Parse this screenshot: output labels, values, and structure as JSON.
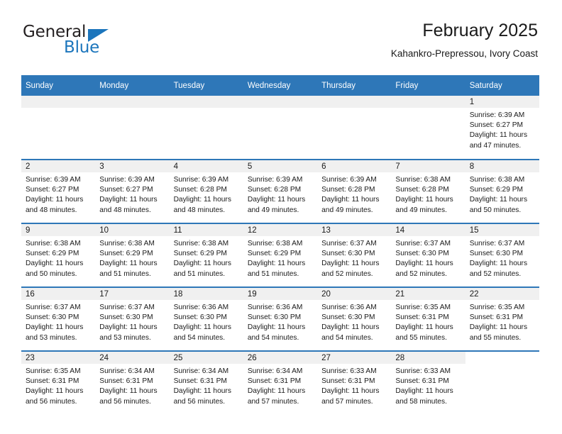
{
  "logo": {
    "primary_text": "General",
    "secondary_text": "Blue",
    "accent_color": "#1b75bc"
  },
  "header": {
    "title": "February 2025",
    "subtitle": "Kahankro-Prepressou, Ivory Coast"
  },
  "theme": {
    "header_row_color": "#2e77b8",
    "day_strip_color": "#f0f0f0",
    "text_color": "#1a1a1a"
  },
  "calendar": {
    "weekday_headers": [
      "Sunday",
      "Monday",
      "Tuesday",
      "Wednesday",
      "Thursday",
      "Friday",
      "Saturday"
    ],
    "weeks": [
      [
        {
          "day": "",
          "lines": []
        },
        {
          "day": "",
          "lines": []
        },
        {
          "day": "",
          "lines": []
        },
        {
          "day": "",
          "lines": []
        },
        {
          "day": "",
          "lines": []
        },
        {
          "day": "",
          "lines": []
        },
        {
          "day": "1",
          "lines": [
            "Sunrise: 6:39 AM",
            "Sunset: 6:27 PM",
            "Daylight: 11 hours and 47 minutes."
          ]
        }
      ],
      [
        {
          "day": "2",
          "lines": [
            "Sunrise: 6:39 AM",
            "Sunset: 6:27 PM",
            "Daylight: 11 hours and 48 minutes."
          ]
        },
        {
          "day": "3",
          "lines": [
            "Sunrise: 6:39 AM",
            "Sunset: 6:27 PM",
            "Daylight: 11 hours and 48 minutes."
          ]
        },
        {
          "day": "4",
          "lines": [
            "Sunrise: 6:39 AM",
            "Sunset: 6:28 PM",
            "Daylight: 11 hours and 48 minutes."
          ]
        },
        {
          "day": "5",
          "lines": [
            "Sunrise: 6:39 AM",
            "Sunset: 6:28 PM",
            "Daylight: 11 hours and 49 minutes."
          ]
        },
        {
          "day": "6",
          "lines": [
            "Sunrise: 6:39 AM",
            "Sunset: 6:28 PM",
            "Daylight: 11 hours and 49 minutes."
          ]
        },
        {
          "day": "7",
          "lines": [
            "Sunrise: 6:38 AM",
            "Sunset: 6:28 PM",
            "Daylight: 11 hours and 49 minutes."
          ]
        },
        {
          "day": "8",
          "lines": [
            "Sunrise: 6:38 AM",
            "Sunset: 6:29 PM",
            "Daylight: 11 hours and 50 minutes."
          ]
        }
      ],
      [
        {
          "day": "9",
          "lines": [
            "Sunrise: 6:38 AM",
            "Sunset: 6:29 PM",
            "Daylight: 11 hours and 50 minutes."
          ]
        },
        {
          "day": "10",
          "lines": [
            "Sunrise: 6:38 AM",
            "Sunset: 6:29 PM",
            "Daylight: 11 hours and 51 minutes."
          ]
        },
        {
          "day": "11",
          "lines": [
            "Sunrise: 6:38 AM",
            "Sunset: 6:29 PM",
            "Daylight: 11 hours and 51 minutes."
          ]
        },
        {
          "day": "12",
          "lines": [
            "Sunrise: 6:38 AM",
            "Sunset: 6:29 PM",
            "Daylight: 11 hours and 51 minutes."
          ]
        },
        {
          "day": "13",
          "lines": [
            "Sunrise: 6:37 AM",
            "Sunset: 6:30 PM",
            "Daylight: 11 hours and 52 minutes."
          ]
        },
        {
          "day": "14",
          "lines": [
            "Sunrise: 6:37 AM",
            "Sunset: 6:30 PM",
            "Daylight: 11 hours and 52 minutes."
          ]
        },
        {
          "day": "15",
          "lines": [
            "Sunrise: 6:37 AM",
            "Sunset: 6:30 PM",
            "Daylight: 11 hours and 52 minutes."
          ]
        }
      ],
      [
        {
          "day": "16",
          "lines": [
            "Sunrise: 6:37 AM",
            "Sunset: 6:30 PM",
            "Daylight: 11 hours and 53 minutes."
          ]
        },
        {
          "day": "17",
          "lines": [
            "Sunrise: 6:37 AM",
            "Sunset: 6:30 PM",
            "Daylight: 11 hours and 53 minutes."
          ]
        },
        {
          "day": "18",
          "lines": [
            "Sunrise: 6:36 AM",
            "Sunset: 6:30 PM",
            "Daylight: 11 hours and 54 minutes."
          ]
        },
        {
          "day": "19",
          "lines": [
            "Sunrise: 6:36 AM",
            "Sunset: 6:30 PM",
            "Daylight: 11 hours and 54 minutes."
          ]
        },
        {
          "day": "20",
          "lines": [
            "Sunrise: 6:36 AM",
            "Sunset: 6:30 PM",
            "Daylight: 11 hours and 54 minutes."
          ]
        },
        {
          "day": "21",
          "lines": [
            "Sunrise: 6:35 AM",
            "Sunset: 6:31 PM",
            "Daylight: 11 hours and 55 minutes."
          ]
        },
        {
          "day": "22",
          "lines": [
            "Sunrise: 6:35 AM",
            "Sunset: 6:31 PM",
            "Daylight: 11 hours and 55 minutes."
          ]
        }
      ],
      [
        {
          "day": "23",
          "lines": [
            "Sunrise: 6:35 AM",
            "Sunset: 6:31 PM",
            "Daylight: 11 hours and 56 minutes."
          ]
        },
        {
          "day": "24",
          "lines": [
            "Sunrise: 6:34 AM",
            "Sunset: 6:31 PM",
            "Daylight: 11 hours and 56 minutes."
          ]
        },
        {
          "day": "25",
          "lines": [
            "Sunrise: 6:34 AM",
            "Sunset: 6:31 PM",
            "Daylight: 11 hours and 56 minutes."
          ]
        },
        {
          "day": "26",
          "lines": [
            "Sunrise: 6:34 AM",
            "Sunset: 6:31 PM",
            "Daylight: 11 hours and 57 minutes."
          ]
        },
        {
          "day": "27",
          "lines": [
            "Sunrise: 6:33 AM",
            "Sunset: 6:31 PM",
            "Daylight: 11 hours and 57 minutes."
          ]
        },
        {
          "day": "28",
          "lines": [
            "Sunrise: 6:33 AM",
            "Sunset: 6:31 PM",
            "Daylight: 11 hours and 58 minutes."
          ]
        },
        {
          "day": "",
          "lines": []
        }
      ]
    ]
  }
}
